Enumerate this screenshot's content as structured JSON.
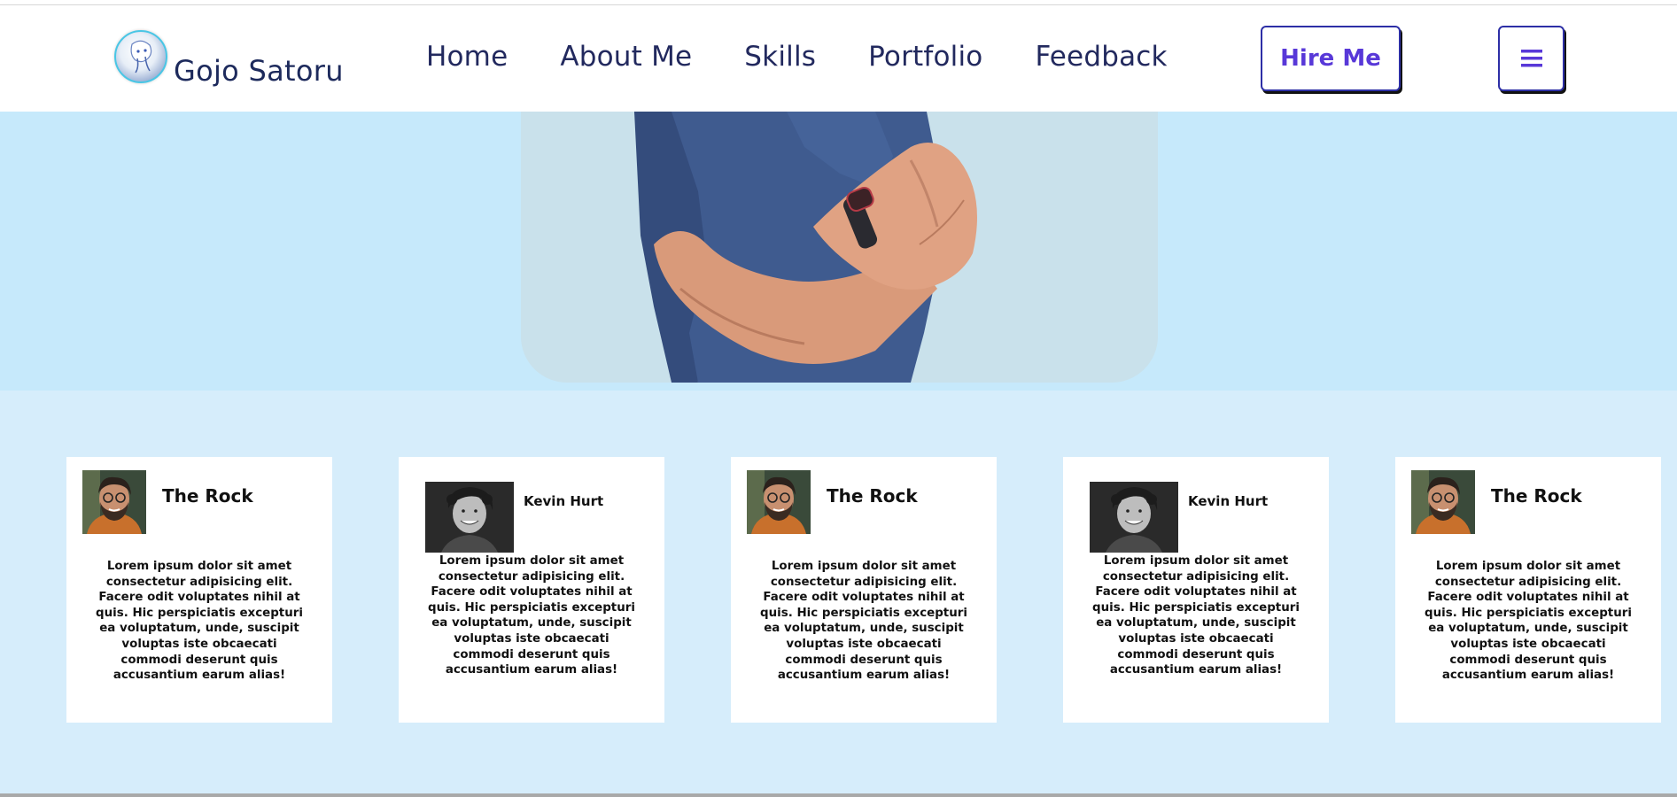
{
  "brand": {
    "name": "Gojo Satoru",
    "logo_icon": "anime-avatar-logo"
  },
  "nav": {
    "links": [
      "Home",
      "About Me",
      "Skills",
      "Portfolio",
      "Feedback"
    ],
    "hire_label": "Hire Me",
    "menu_icon": "hamburger-icon"
  },
  "colors": {
    "nav_text": "#22295e",
    "accent": "#5838d8",
    "hero_bg": "#c6e9fb",
    "section_bg": "#d6edfb"
  },
  "testimonials": [
    {
      "name": "The Rock",
      "avatar": "bearded-man-glasses-photo",
      "text": "Lorem ipsum dolor sit amet consectetur adipisicing elit. Facere odit voluptates nihil at quis. Hic perspiciatis excepturi ea voluptatum, unde, suscipit voluptas iste obcaecati commodi deserunt quis accusantium earum alias!"
    },
    {
      "name": "Kevin Hurt",
      "avatar": "curly-hair-man-bw-photo",
      "text": "Lorem ipsum dolor sit amet consectetur adipisicing elit. Facere odit voluptates nihil at quis. Hic perspiciatis excepturi ea voluptatum, unde, suscipit voluptas iste obcaecati commodi deserunt quis accusantium earum alias!"
    },
    {
      "name": "The Rock",
      "avatar": "bearded-man-glasses-photo",
      "text": "Lorem ipsum dolor sit amet consectetur adipisicing elit. Facere odit voluptates nihil at quis. Hic perspiciatis excepturi ea voluptatum, unde, suscipit voluptas iste obcaecati commodi deserunt quis accusantium earum alias!"
    },
    {
      "name": "Kevin Hurt",
      "avatar": "curly-hair-man-bw-photo",
      "text": "Lorem ipsum dolor sit amet consectetur adipisicing elit. Facere odit voluptates nihil at quis. Hic perspiciatis excepturi ea voluptatum, unde, suscipit voluptas iste obcaecati commodi deserunt quis accusantium earum alias!"
    },
    {
      "name": "The Rock",
      "avatar": "bearded-man-glasses-photo",
      "text": "Lorem ipsum dolor sit amet consectetur adipisicing elit. Facere odit voluptates nihil at quis. Hic perspiciatis excepturi ea voluptatum, unde, suscipit voluptas iste obcaecati commodi deserunt quis accusantium earum alias!"
    }
  ]
}
